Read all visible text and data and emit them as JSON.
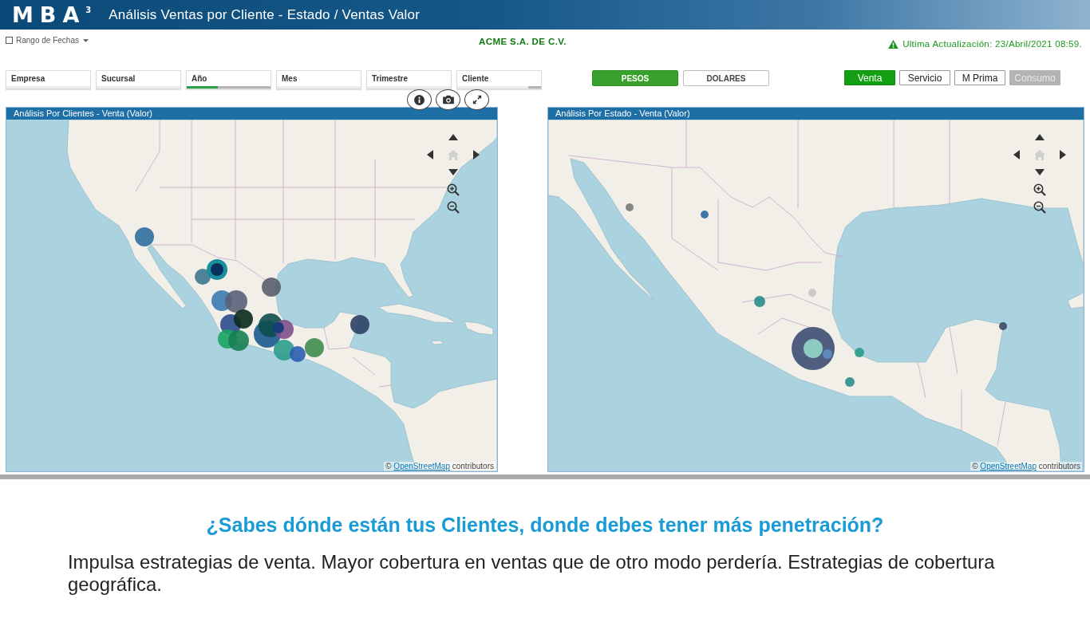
{
  "header": {
    "logo": "MBA$^{3}$",
    "title": "Análisis Ventas por Cliente - Estado / Ventas Valor"
  },
  "date_range": {
    "label": "Rango de Fechas",
    "checked": false
  },
  "company": "ACME S.A. DE C.V.",
  "last_update": "Ultima Actualización: 23/Abril/2021 08:59.",
  "filters": [
    {
      "label": "Empresa"
    },
    {
      "label": "Sucursal"
    },
    {
      "label": "Año",
      "selection": {
        "level": 0.37
      },
      "exclusion": {
        "level": 0.63
      }
    },
    {
      "label": "Mes"
    },
    {
      "label": "Trimestre"
    },
    {
      "label": "Cliente",
      "exclusion": {
        "level": 0.15
      }
    }
  ],
  "currency": [
    {
      "label": "PESOS",
      "selected": true
    },
    {
      "label": "DOLARES",
      "selected": false
    }
  ],
  "measure": [
    {
      "label": "Venta",
      "selected": true,
      "disabled": false
    },
    {
      "label": "Servicio",
      "selected": false,
      "disabled": false
    },
    {
      "label": "M Prima",
      "selected": false,
      "disabled": false
    },
    {
      "label": "Consumo",
      "selected": false,
      "disabled": true
    }
  ],
  "panels": [
    {
      "kind": "clients",
      "title": "Análisis Por Clientes - Venta (Valor)",
      "attribution": {
        "symbol": "©",
        "link": "OpenStreetMap",
        "text": "contributors"
      }
    },
    {
      "kind": "states",
      "title": "Análisis Por Estado - Venta (Valor)",
      "attribution": {
        "symbol": "©",
        "link": "OpenStreetMap",
        "text": "contributors"
      }
    }
  ],
  "promo": {
    "heading": "¿Sabes dónde están tus Clientes, donde debes tener más penetración?",
    "text": "Impulsa estrategias de venta. Mayor cobertura en ventas que de otro modo perdería. Estrategias de cobertura geográfica."
  }
}
